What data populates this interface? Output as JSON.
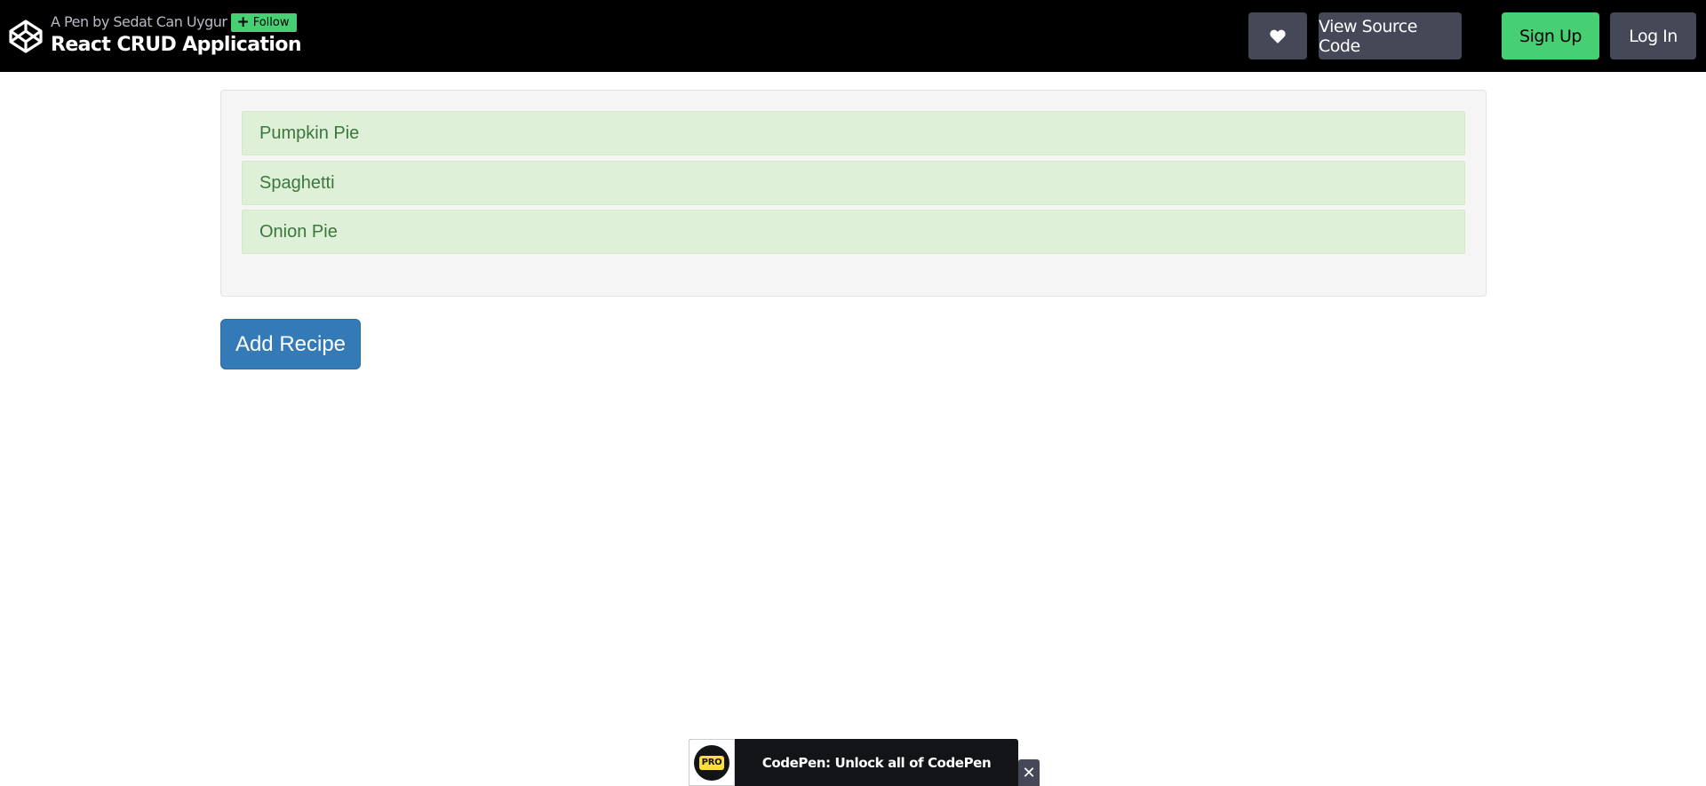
{
  "header": {
    "author_line": "A Pen by Sedat Can Uygur",
    "follow_label": "Follow",
    "title": "React CRUD Application",
    "buttons": {
      "heart_icon": "heart-icon",
      "view_source": "View Source Code",
      "sign_up": "Sign Up",
      "log_in": "Log In"
    },
    "colors": {
      "bar": "#000000",
      "button_gray": "#444857",
      "button_green": "#47cf73"
    }
  },
  "recipes": {
    "items": [
      "Pumpkin Pie",
      "Spaghetti",
      "Onion Pie"
    ],
    "add_button": "Add Recipe",
    "colors": {
      "item_bg": "#dff0d8",
      "item_text": "#3c763d",
      "primary": "#337ab7"
    }
  },
  "promo": {
    "badge": "PRO",
    "text": "CodePen: Unlock all of CodePen",
    "close_icon": "close-icon",
    "colors": {
      "badge_yellow": "#ffdd40",
      "banner_bg": "#131417"
    }
  }
}
